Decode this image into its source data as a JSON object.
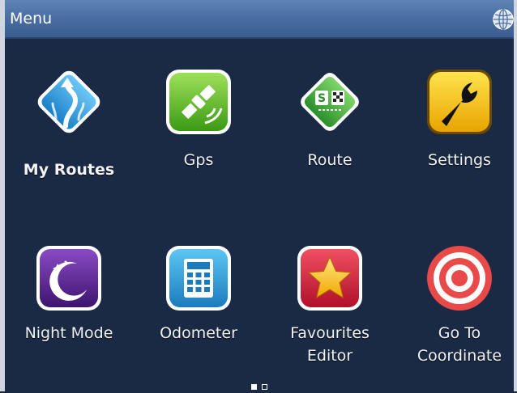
{
  "header": {
    "title": "Menu",
    "globe_icon": "globe-icon"
  },
  "menu": [
    {
      "id": "my-routes",
      "line1": "My Routes",
      "line2": "",
      "icon": "my-routes-icon",
      "color": "#3fa7e6"
    },
    {
      "id": "gps",
      "line1": "Gps",
      "line2": "",
      "icon": "satellite-icon",
      "color": "#5fbf2a"
    },
    {
      "id": "route",
      "line1": "Route",
      "line2": "",
      "icon": "route-icon",
      "color": "#3aa53a"
    },
    {
      "id": "settings",
      "line1": "Settings",
      "line2": "",
      "icon": "wrench-icon",
      "color": "#f2c200"
    },
    {
      "id": "night-mode",
      "line1": "Night Mode",
      "line2": "",
      "icon": "moon-icon",
      "color": "#6a2a9c"
    },
    {
      "id": "odometer",
      "line1": "Odometer",
      "line2": "",
      "icon": "calculator-icon",
      "color": "#2d9bd6"
    },
    {
      "id": "favourites-editor",
      "line1": "Favourites",
      "line2": "Editor",
      "icon": "star-icon",
      "color": "#d8203a"
    },
    {
      "id": "go-to-coordinate",
      "line1": "Go To",
      "line2": "Coordinate",
      "icon": "target-icon",
      "color": "#e84a4a"
    }
  ],
  "pager": {
    "pages": 2,
    "current": 1
  }
}
